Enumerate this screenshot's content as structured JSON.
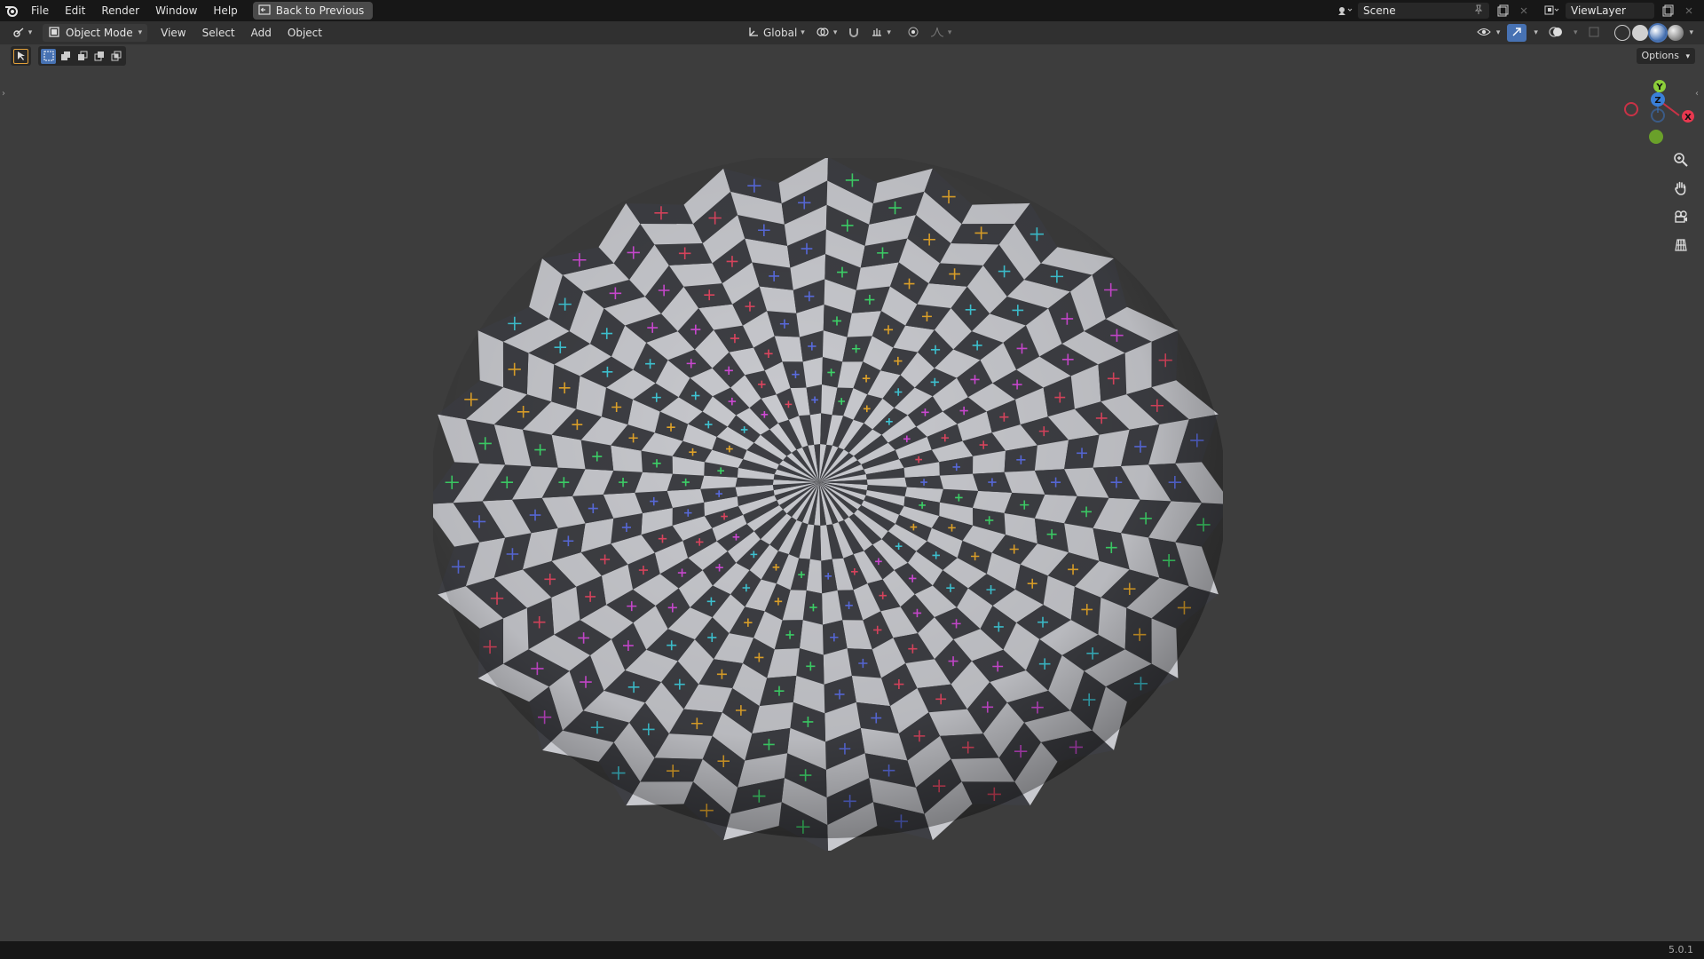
{
  "topbar": {
    "menus": [
      "File",
      "Edit",
      "Render",
      "Window",
      "Help"
    ],
    "back_label": "Back to Previous",
    "scene": "Scene",
    "view_layer": "ViewLayer"
  },
  "header": {
    "mode": "Object Mode",
    "menus": [
      "View",
      "Select",
      "Add",
      "Object"
    ],
    "transform_orientation": "Global"
  },
  "toolrow": {
    "options_label": "Options"
  },
  "viewport": {
    "object": "uv-checker-sphere",
    "gizmo": {
      "x": "X",
      "y": "Y",
      "z": "Z"
    }
  },
  "status": {
    "version": "5.0.1"
  },
  "colors": {
    "checker_light": "#c8c9ce",
    "checker_dark": "#3e3f44",
    "marker_colors": [
      "#3ed66a",
      "#e4a62a",
      "#3fc7d6",
      "#d04ad6",
      "#e04660",
      "#5a6ce0"
    ]
  }
}
